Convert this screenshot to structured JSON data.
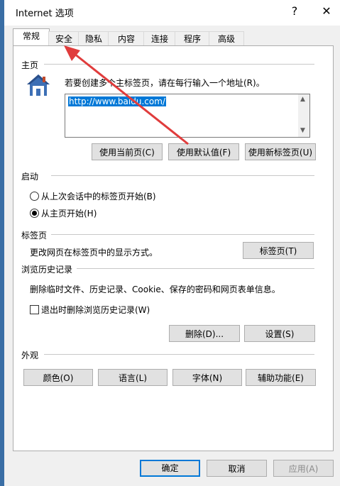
{
  "window": {
    "title": "Internet 选项",
    "help": "?",
    "close": "✕"
  },
  "tabs": [
    {
      "label": "常规"
    },
    {
      "label": "安全"
    },
    {
      "label": "隐私"
    },
    {
      "label": "内容"
    },
    {
      "label": "连接"
    },
    {
      "label": "程序"
    },
    {
      "label": "高级"
    }
  ],
  "home": {
    "section": "主页",
    "description": "若要创建多个主标签页，请在每行输入一个地址(R)。",
    "url": "http://www.baidu.com/",
    "btn_current": "使用当前页(C)",
    "btn_default": "使用默认值(F)",
    "btn_newtab": "使用新标签页(U)"
  },
  "startup": {
    "section": "启动",
    "option_last": "从上次会话中的标签页开始(B)",
    "option_home": "从主页开始(H)",
    "selected": "home"
  },
  "tabsgroup": {
    "section": "标签页",
    "description": "更改网页在标签页中的显示方式。",
    "button": "标签页(T)"
  },
  "history": {
    "section": "浏览历史记录",
    "description": "删除临时文件、历史记录、Cookie、保存的密码和网页表单信息。",
    "checkbox": "退出时删除浏览历史记录(W)",
    "btn_delete": "删除(D)...",
    "btn_settings": "设置(S)"
  },
  "appearance": {
    "section": "外观",
    "btn_colors": "颜色(O)",
    "btn_languages": "语言(L)",
    "btn_fonts": "字体(N)",
    "btn_accessibility": "辅助功能(E)"
  },
  "footer": {
    "ok": "确定",
    "cancel": "取消",
    "apply": "应用(A)"
  },
  "colors": {
    "accent": "#0078d7",
    "annotation_arrow": "#e03c3c"
  }
}
